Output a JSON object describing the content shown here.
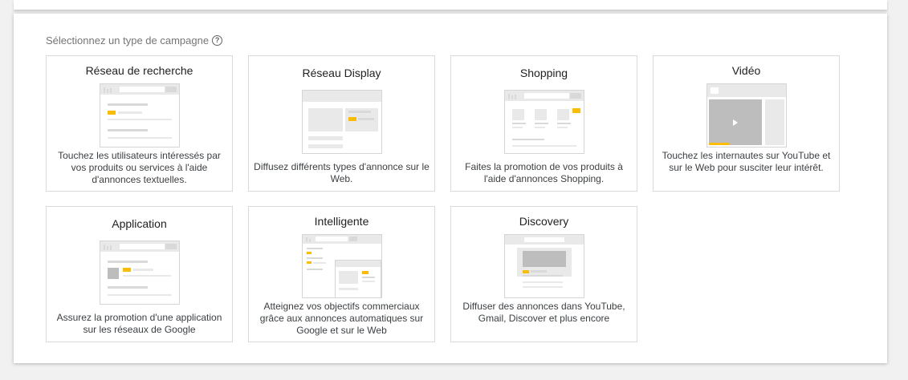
{
  "heading": "Sélectionnez un type de campagne",
  "help_icon_glyph": "?",
  "colors": {
    "accent": "#fbbc04",
    "border": "#dadada",
    "illustration_gray": "#d9d9d9"
  },
  "cards": [
    {
      "title": "Réseau de recherche",
      "description": "Touchez les utilisateurs intéressés par vos produits ou services à l'aide d'annonces textuelles.",
      "icon": "search-ad-illustration"
    },
    {
      "title": "Réseau Display",
      "description": "Diffusez différents types d'annonce sur le Web.",
      "icon": "display-ad-illustration"
    },
    {
      "title": "Shopping",
      "description": "Faites la promotion de vos produits à l'aide d'annonces Shopping.",
      "icon": "shopping-ad-illustration"
    },
    {
      "title": "Vidéo",
      "description": "Touchez les internautes sur YouTube et sur le Web pour susciter leur intérêt.",
      "icon": "video-ad-illustration"
    },
    {
      "title": "Application",
      "description": "Assurez la promotion d'une application sur les réseaux de Google",
      "icon": "app-ad-illustration"
    },
    {
      "title": "Intelligente",
      "description": "Atteignez vos objectifs commerciaux grâce aux annonces automatiques sur Google et sur le Web",
      "icon": "smart-ad-illustration"
    },
    {
      "title": "Discovery",
      "description": "Diffuser des annonces dans YouTube, Gmail, Discover et plus encore",
      "icon": "discovery-ad-illustration"
    }
  ]
}
